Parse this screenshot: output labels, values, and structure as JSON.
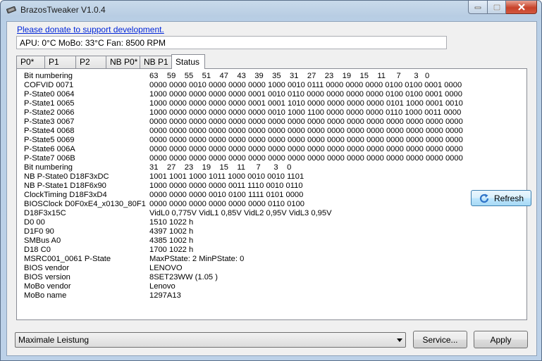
{
  "window": {
    "title": "BrazosTweaker V1.0.4"
  },
  "donate_link": "Please donate to support development.",
  "sensor_readout": "APU: 0°C MoBo: 33°C Fan: 8500 RPM",
  "tabs": [
    "P0*",
    "P1",
    "P2",
    "NB P0*",
    "NB P1",
    "Status"
  ],
  "active_tab": "Status",
  "status_rows": [
    {
      "label": "Bit numbering",
      "value": "63    59    55    51    47    43    39    35    31    27    23    19    15    11     7      3   0"
    },
    {
      "label": "COFVID 0071",
      "value": "0000 0000 0010 0000 0000 0000 1000 0010 0111 0000 0000 0000 0100 0100 0001 0000"
    },
    {
      "label": "P-State0 0064",
      "value": "1000 0000 0000 0000 0000 0001 0010 0110 0000 0000 0000 0000 0100 0100 0001 0000"
    },
    {
      "label": "P-State1 0065",
      "value": "1000 0000 0000 0000 0000 0001 0001 1010 0000 0000 0000 0000 0101 1000 0001 0010"
    },
    {
      "label": "P-State2 0066",
      "value": "1000 0000 0000 0000 0000 0000 0010 1000 1100 0000 0000 0000 0110 1000 0011 0000"
    },
    {
      "label": "P-State3 0067",
      "value": "0000 0000 0000 0000 0000 0000 0000 0000 0000 0000 0000 0000 0000 0000 0000 0000"
    },
    {
      "label": "P-State4 0068",
      "value": "0000 0000 0000 0000 0000 0000 0000 0000 0000 0000 0000 0000 0000 0000 0000 0000"
    },
    {
      "label": "P-State5 0069",
      "value": "0000 0000 0000 0000 0000 0000 0000 0000 0000 0000 0000 0000 0000 0000 0000 0000"
    },
    {
      "label": "P-State6 006A",
      "value": "0000 0000 0000 0000 0000 0000 0000 0000 0000 0000 0000 0000 0000 0000 0000 0000"
    },
    {
      "label": "P-State7 006B",
      "value": "0000 0000 0000 0000 0000 0000 0000 0000 0000 0000 0000 0000 0000 0000 0000 0000"
    },
    {
      "label": "Bit numbering",
      "value": "31    27    23    19    15    11     7      3    0"
    },
    {
      "label": "NB P-State0 D18F3xDC",
      "value": "1001 1001 1000 1011 1000 0010 0010 1101"
    },
    {
      "label": "NB P-State1 D18F6x90",
      "value": "1000 0000 0000 0000 0011 1110 0010 0110"
    },
    {
      "label": "ClockTiming D18F3xD4",
      "value": "0000 0000 0000 0010 0100 1111 0101 0000"
    },
    {
      "label": "BIOSClock D0F0xE4_x0130_80F1",
      "value": "0000 0000 0000 0000 0000 0000 0110 0100"
    },
    {
      "label": "D18F3x15C",
      "value": "VidL0 0,775V VidL1 0,85V VidL2 0,95V VidL3 0,95V"
    },
    {
      "label": "D0 00",
      "value": "1510 1022 h"
    },
    {
      "label": "D1F0 90",
      "value": "4397 1002 h"
    },
    {
      "label": "SMBus A0",
      "value": "4385 1002 h"
    },
    {
      "label": "D18 C0",
      "value": "1700 1022 h"
    },
    {
      "label": "MSRC001_0061 P-State",
      "value": "MaxPState: 2 MinPState: 0"
    },
    {
      "label": "BIOS vendor",
      "value": "LENOVO"
    },
    {
      "label": "BIOS version",
      "value": "8SET23WW (1.05 )"
    },
    {
      "label": "MoBo vendor",
      "value": "Lenovo"
    },
    {
      "label": "MoBo name",
      "value": "1297A13"
    }
  ],
  "buttons": {
    "refresh": "Refresh",
    "service": "Service...",
    "apply": "Apply"
  },
  "power_scheme": {
    "selected": "Maximale Leistung"
  },
  "icons": {
    "app": "chip-icon",
    "refresh": "refresh-icon",
    "minimize": "minimize-icon",
    "maximize": "maximize-icon",
    "close": "close-icon"
  },
  "colors": {
    "link": "#0026d8",
    "close_button": "#c7432a"
  }
}
